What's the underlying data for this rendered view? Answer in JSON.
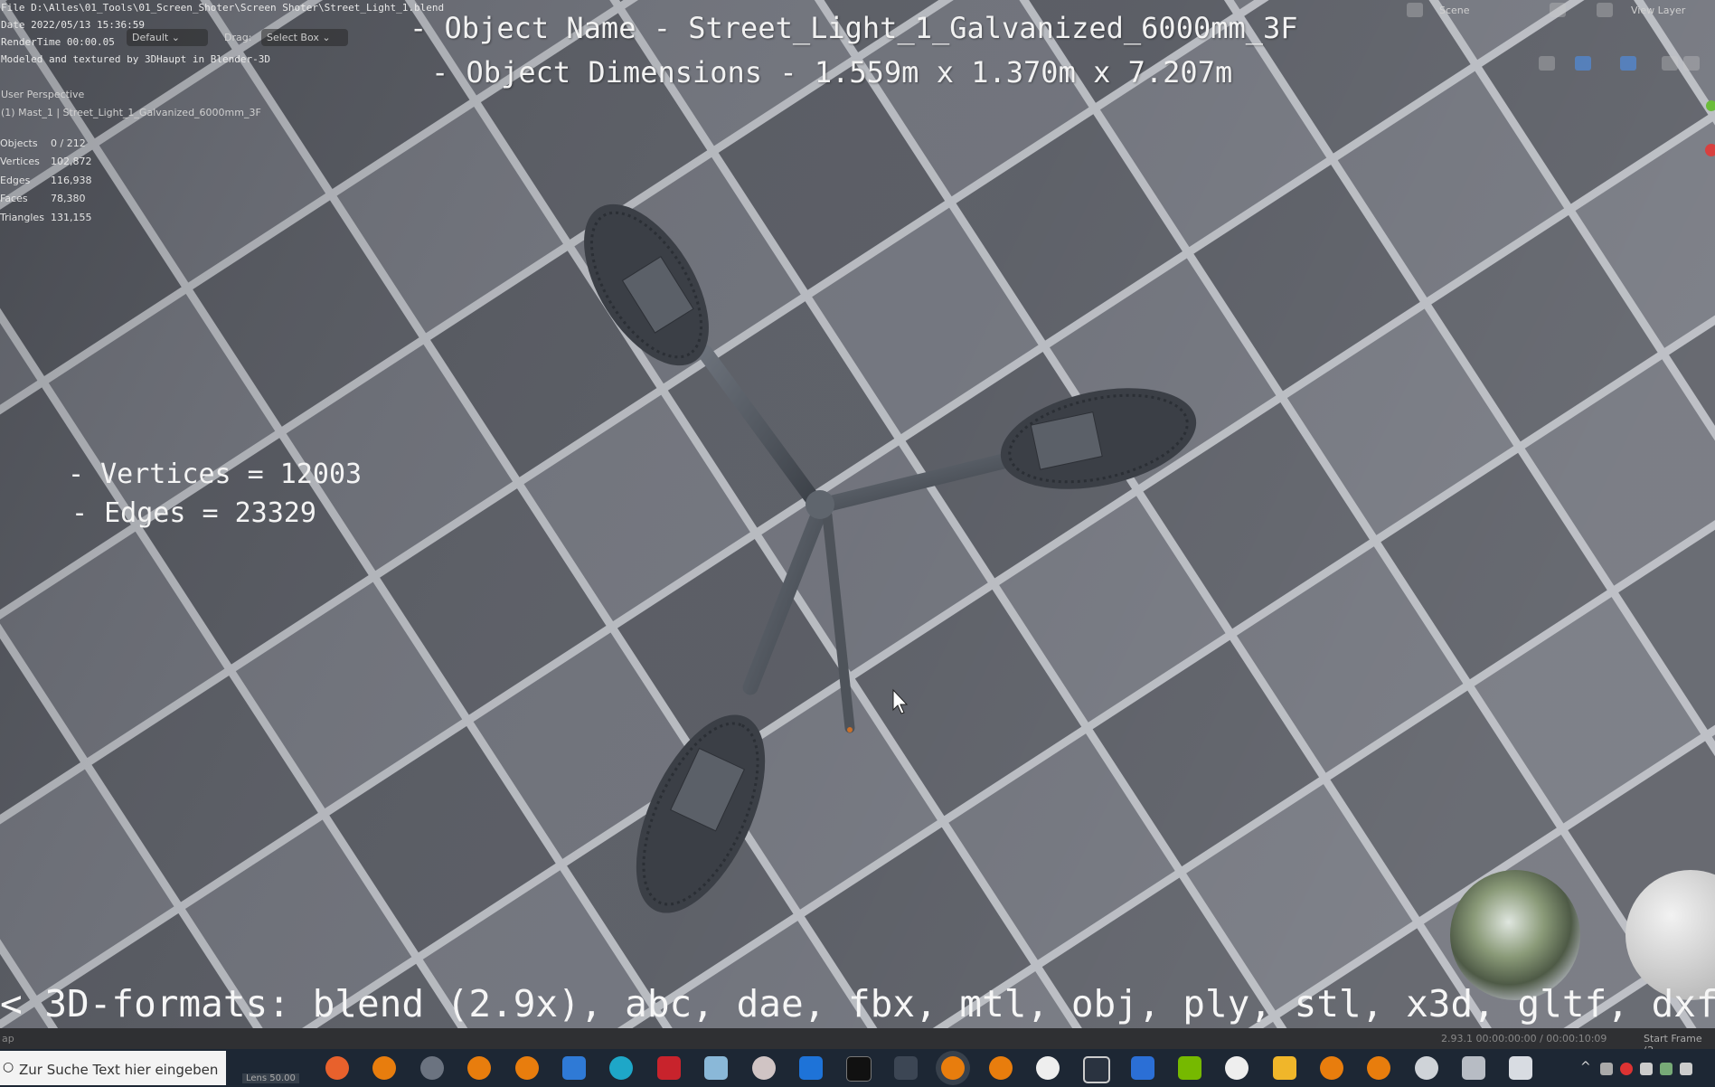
{
  "overlay": {
    "file_line": "File D:\\Alles\\01_Tools\\01_Screen_Shoter\\Screen Shoter\\Street_Light_1.blend",
    "date_line": "Date 2022/05/13 15:36:59",
    "render_time_line": "RenderTime 00:00.05",
    "credit_line": "Modeled and textured by 3DHaupt in Blender-3D",
    "object_name_line": "- Object Name - Street_Light_1_Galvanized_6000mm_3F",
    "object_dimensions_line": "- Object Dimensions -  1.559m x 1.370m x 7.207m",
    "vertices_line": "- Vertices = 12003",
    "edges_line": "- Edges = 23329",
    "formats_line": "< 3D-formats: blend (2.9x), abc, dae, fbx, mtl, obj, ply, stl, x3d, gltf, dxf"
  },
  "header": {
    "orientation_value": "Default",
    "drag_label": "Drag:",
    "drag_value": "Select Box",
    "scene_label": "Scene",
    "view_layer_label": "View Layer"
  },
  "viewport": {
    "perspective_label": "User Perspective",
    "active_object_label": "(1) Mast_1 | Street_Light_1_Galvanized_6000mm_3F",
    "stats": [
      {
        "key": "Objects",
        "value": "0 / 212"
      },
      {
        "key": "Vertices",
        "value": "102,872"
      },
      {
        "key": "Edges",
        "value": "116,938"
      },
      {
        "key": "Faces",
        "value": "78,380"
      },
      {
        "key": "Triangles",
        "value": "131,155"
      }
    ]
  },
  "statusbar": {
    "left_text": "ap",
    "version_and_time": "2.93.1  00:00:00:00 / 00:00:10:09",
    "start_frame": "Start Frame (2"
  },
  "taskbar": {
    "search_placeholder": "Zur Suche Text hier eingeben",
    "ghost_items": [
      "Lens 50.00"
    ],
    "icons": [
      "firefox-icon",
      "blender-icon",
      "steam-icon",
      "blender-icon",
      "blender-icon",
      "mail-icon",
      "edge-icon",
      "app-red-icon",
      "files-icon",
      "paint-icon",
      "outlook-icon",
      "terminal-icon",
      "network-icon",
      "blender-icon",
      "blender-icon",
      "panda-icon",
      "cube-icon",
      "calendar-icon",
      "nvidia-icon",
      "app-white-icon",
      "folder-icon",
      "blender-icon",
      "blender-icon",
      "settings-icon",
      "window-icon",
      "chat-icon"
    ]
  },
  "colors": {
    "viewport_dark_tile": "#4d5058",
    "viewport_light_tile": "#6f727b",
    "grid_line": "#b9bcc2",
    "taskbar_bg": "#1d2734",
    "statusbar_bg": "#2f3033"
  }
}
